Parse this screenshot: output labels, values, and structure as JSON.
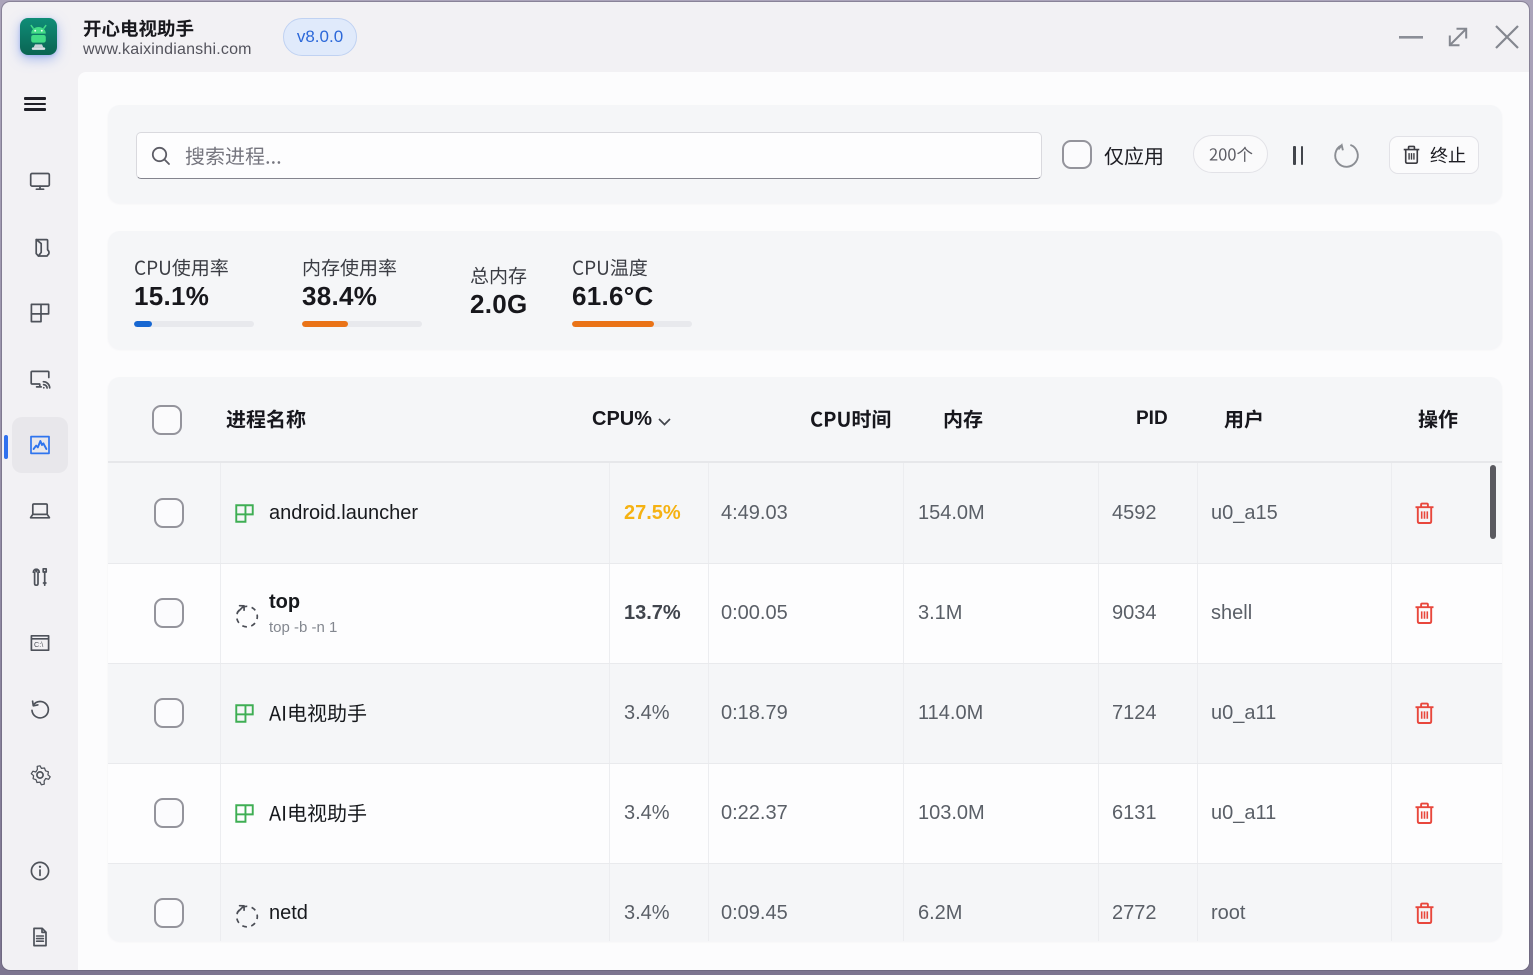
{
  "theme": {
    "accent_blue": "#2e74ee",
    "cpu_bar_blue": "#1767d2",
    "warn_orange": "#ea7317",
    "hot_amber": "#f5b213",
    "danger_red": "#e8473c"
  },
  "titlebar": {
    "app_title": "开心电视助手",
    "app_subtitle": "www.kaixindianshi.com",
    "version_badge": "v8.0.0",
    "controls": {
      "minimize": "最小化",
      "resize": "缩放",
      "close": "关闭"
    }
  },
  "sidebar": {
    "menu": "菜单",
    "items": [
      {
        "id": "monitor"
      },
      {
        "id": "package"
      },
      {
        "id": "layout-grid"
      },
      {
        "id": "screencast"
      },
      {
        "id": "performance",
        "active": true
      },
      {
        "id": "laptop"
      },
      {
        "id": "tools"
      },
      {
        "id": "terminal"
      },
      {
        "id": "history"
      },
      {
        "id": "settings"
      },
      {
        "id": "info"
      },
      {
        "id": "document"
      }
    ]
  },
  "toolbar": {
    "search_placeholder": "搜索进程...",
    "search_value": "",
    "apps_only_label": "仅应用",
    "apps_only_checked": false,
    "process_count": "200个",
    "kill_label": "终止"
  },
  "stats": [
    {
      "label": "CPU使用率",
      "value": "15.1%",
      "bar_pct": 15,
      "bar_color": "#1767d2"
    },
    {
      "label": "内存使用率",
      "value": "38.4%",
      "bar_pct": 38.4,
      "bar_color": "#ea7317"
    },
    {
      "label": "总内存",
      "value": "2.0G"
    },
    {
      "label": "CPU温度",
      "value": "61.6°C",
      "bar_pct": 68,
      "bar_color": "#ea7317"
    }
  ],
  "table": {
    "columns": {
      "name": "进程名称",
      "cpu": "CPU%",
      "time": "CPU时间",
      "mem": "内存",
      "pid": "PID",
      "user": "用户",
      "ops": "操作"
    },
    "sort_column": "cpu",
    "rows": [
      {
        "name": "android.launcher",
        "icon": "app",
        "cpu": "27.5%",
        "cpu_level": "hot",
        "time": "4:49.03",
        "mem": "154.0M",
        "pid": "4592",
        "user": "u0_a15"
      },
      {
        "name": "top",
        "sub": "top -b -n 1",
        "icon": "process",
        "cpu": "13.7%",
        "cpu_level": "warm",
        "time": "0:00.05",
        "mem": "3.1M",
        "pid": "9034",
        "user": "shell"
      },
      {
        "name": "AI电视助手",
        "icon": "app",
        "cpu": "3.4%",
        "cpu_level": "norm",
        "time": "0:18.79",
        "mem": "114.0M",
        "pid": "7124",
        "user": "u0_a11"
      },
      {
        "name": "AI电视助手",
        "icon": "app",
        "cpu": "3.4%",
        "cpu_level": "norm",
        "time": "0:22.37",
        "mem": "103.0M",
        "pid": "6131",
        "user": "u0_a11"
      },
      {
        "name": "netd",
        "icon": "process",
        "cpu": "3.4%",
        "cpu_level": "norm",
        "time": "0:09.45",
        "mem": "6.2M",
        "pid": "2772",
        "user": "root"
      }
    ]
  }
}
